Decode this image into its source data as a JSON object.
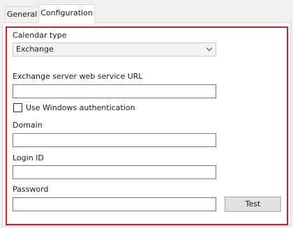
{
  "tabs": [
    {
      "label": "General",
      "active": false
    },
    {
      "label": "Configuration",
      "active": true
    }
  ],
  "form": {
    "calendar_type_label": "Calendar type",
    "calendar_type_value": "Exchange",
    "url_label": "Exchange server web service URL",
    "url_value": "",
    "windows_auth_label": "Use Windows authentication",
    "windows_auth_checked": false,
    "domain_label": "Domain",
    "domain_value": "",
    "login_label": "Login ID",
    "login_value": "",
    "password_label": "Password",
    "password_value": "",
    "test_button": "Test"
  },
  "colors": {
    "highlight_frame": "#d0202a",
    "panel_background": "#ffffff",
    "window_background": "#f0f0f0"
  }
}
